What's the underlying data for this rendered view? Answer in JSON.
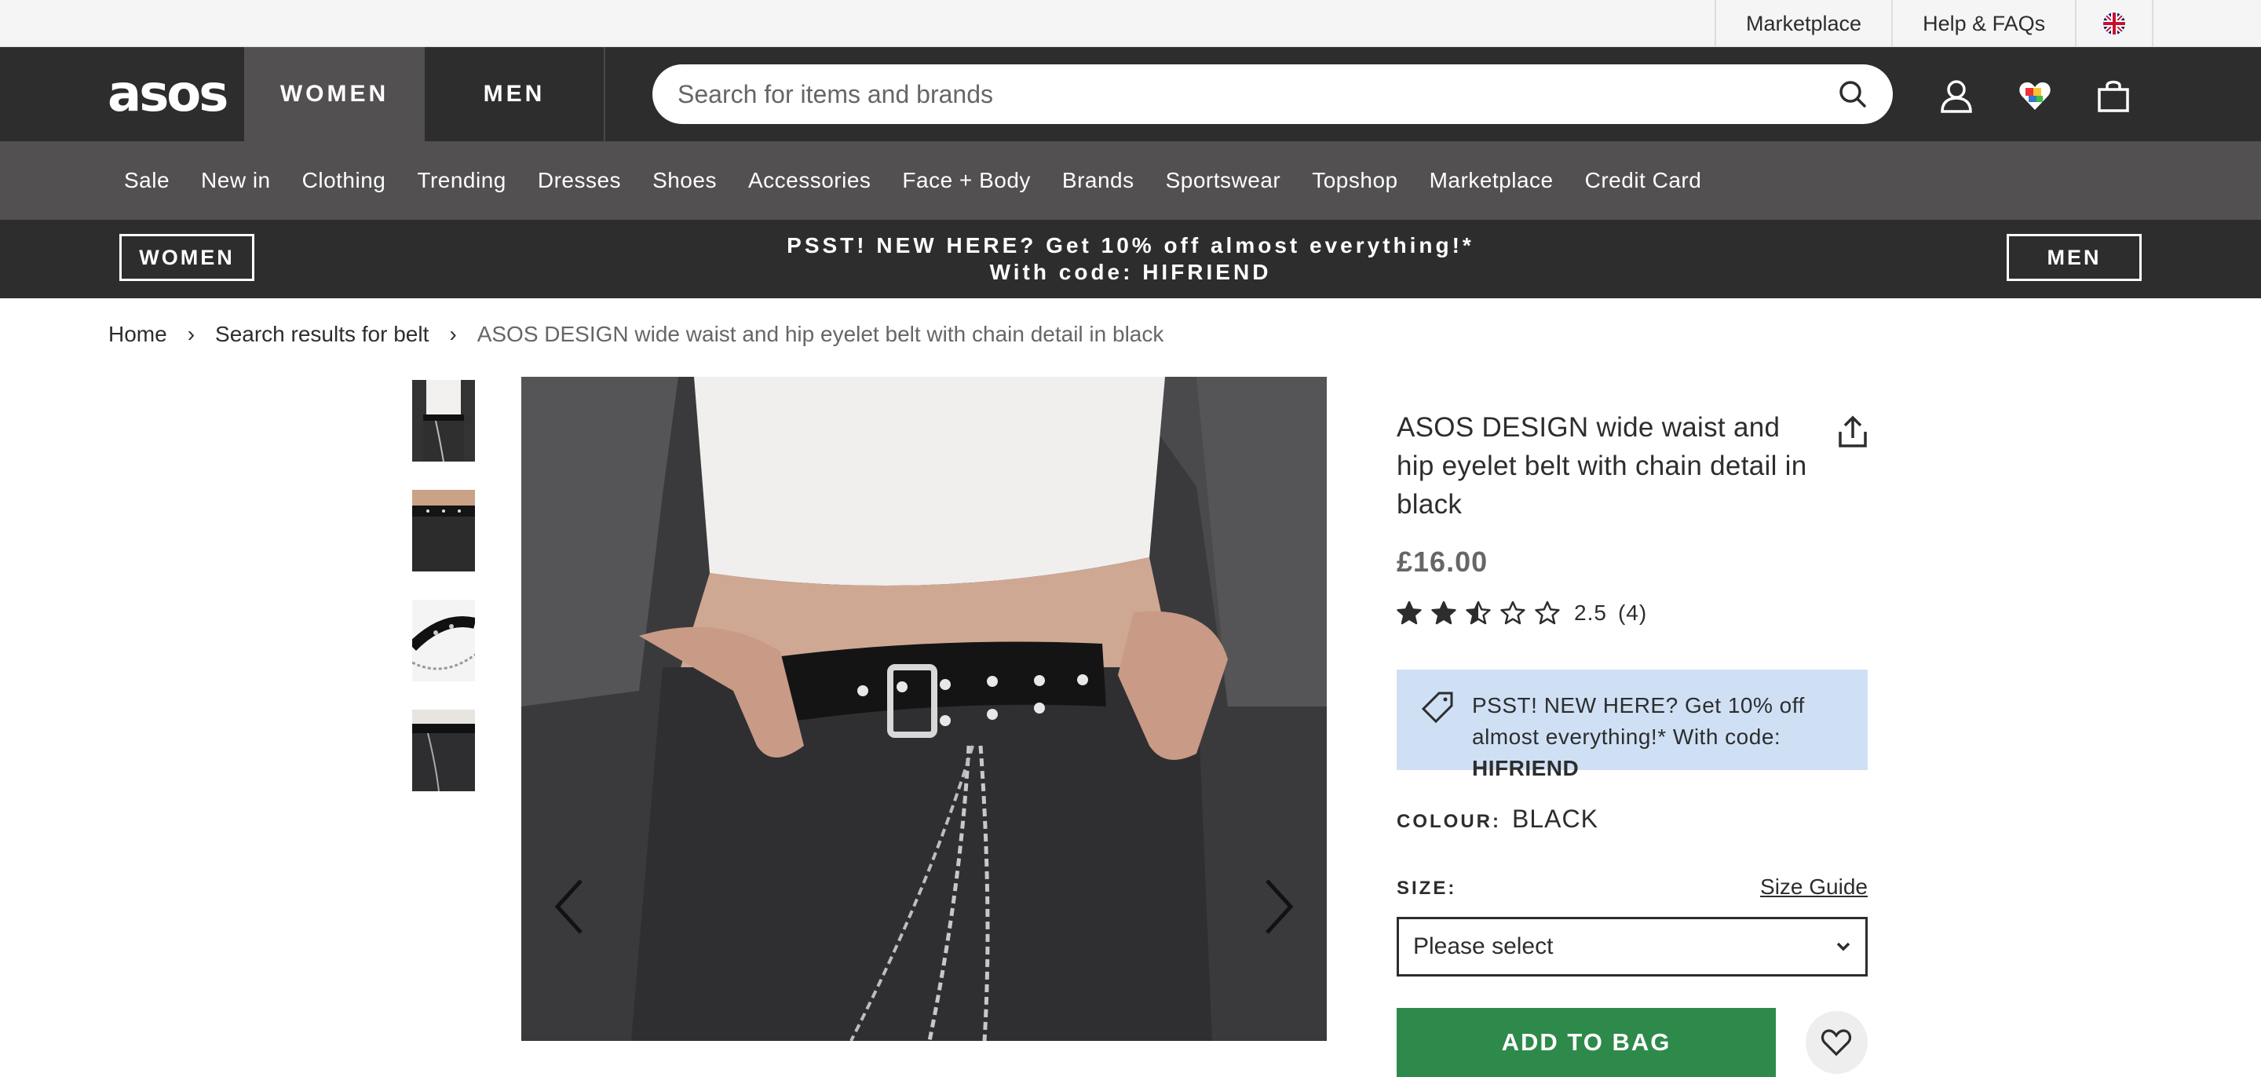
{
  "topbar": {
    "links": [
      {
        "label": "Marketplace"
      },
      {
        "label": "Help & FAQs"
      }
    ],
    "flag_icon": "uk-flag-icon"
  },
  "header": {
    "logo": "asos",
    "tabs": [
      {
        "label": "WOMEN",
        "active": true
      },
      {
        "label": "MEN",
        "active": false
      }
    ],
    "search_placeholder": "Search for items and brands",
    "icons": [
      "search-icon",
      "account-icon",
      "saved-items-icon",
      "bag-icon"
    ]
  },
  "category_nav": {
    "items": [
      "Sale",
      "New in",
      "Clothing",
      "Trending",
      "Dresses",
      "Shoes",
      "Accessories",
      "Face + Body",
      "Brands",
      "Sportswear",
      "Topshop",
      "Marketplace",
      "Credit Card"
    ]
  },
  "promo_bar": {
    "women_button": "WOMEN",
    "men_button": "MEN",
    "line1": "PSST! NEW HERE? Get 10% off almost everything!*",
    "line2": "With code: HIFRIEND"
  },
  "breadcrumb": {
    "items": [
      "Home",
      "Search results for belt"
    ],
    "separator": "›",
    "current": "ASOS DESIGN wide waist and hip eyelet belt with chain detail in black"
  },
  "product": {
    "title": "ASOS DESIGN wide waist and hip eyelet belt with chain detail in black",
    "price": "£16.00",
    "rating": {
      "value": 2.5,
      "out_of": 5,
      "value_text": "2.5",
      "count_text": "(4)"
    },
    "promo": {
      "text": "PSST! NEW HERE? Get 10% off almost everything!* With code: ",
      "code": "HIFRIEND"
    },
    "colour_label": "COLOUR:",
    "colour_value": "BLACK",
    "size_label": "SIZE:",
    "size_guide": "Size Guide",
    "size_select": {
      "value": "Please select"
    },
    "add_to_bag": "ADD TO BAG",
    "thumbnail_count": 4
  },
  "colors": {
    "header_bg": "#2d2d2d",
    "nav_bg": "#525050",
    "promo_box_bg": "#cfe0f5",
    "add_to_bag_bg": "#2e8a4a"
  }
}
